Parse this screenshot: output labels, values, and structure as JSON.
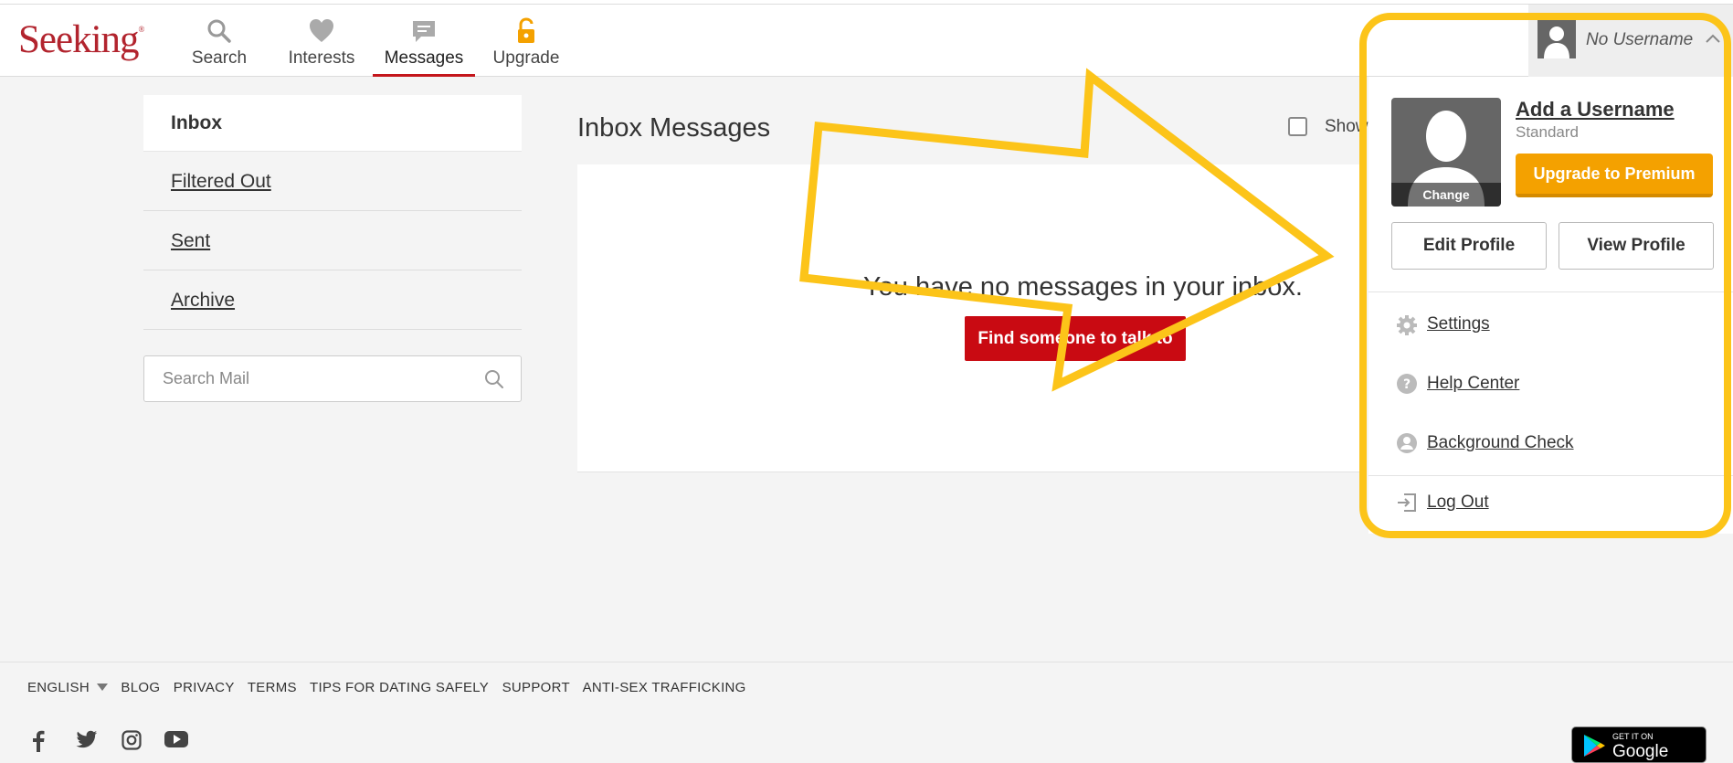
{
  "header": {
    "logo": "Seeking",
    "logo_mark": "®",
    "nav": [
      {
        "label": "Search",
        "icon": "search-icon"
      },
      {
        "label": "Interests",
        "icon": "heart-icon"
      },
      {
        "label": "Messages",
        "icon": "chat-icon"
      },
      {
        "label": "Upgrade",
        "icon": "lock-icon"
      }
    ]
  },
  "sidebar": {
    "items": [
      {
        "label": "Inbox"
      },
      {
        "label": "Filtered Out"
      },
      {
        "label": "Sent"
      },
      {
        "label": "Archive"
      }
    ],
    "search_placeholder": "Search Mail"
  },
  "main": {
    "title": "Inbox Messages",
    "show_label": "Show",
    "empty_message": "You have no messages in your inbox.",
    "find_button": "Find someone to talk to"
  },
  "dropdown": {
    "username": "No Username",
    "photo_change": "Change",
    "add_username": "Add a Username",
    "tier": "Standard",
    "upgrade_button": "Upgrade to Premium",
    "edit_profile": "Edit Profile",
    "view_profile": "View Profile",
    "settings": "Settings",
    "help_center": "Help Center",
    "background_check": "Background Check",
    "log_out": "Log Out"
  },
  "footer": {
    "language": "ENGLISH",
    "links": [
      "BLOG",
      "PRIVACY",
      "TERMS",
      "TIPS FOR DATING SAFELY",
      "SUPPORT",
      "ANTI-SEX TRAFFICKING"
    ],
    "google_play_small": "GET IT ON",
    "google_play_big": "Google Play"
  },
  "colors": {
    "brand_red": "#b2242e",
    "button_red": "#c90a12",
    "upgrade_orange": "#f4a100",
    "annotation_yellow": "#fcc419"
  }
}
